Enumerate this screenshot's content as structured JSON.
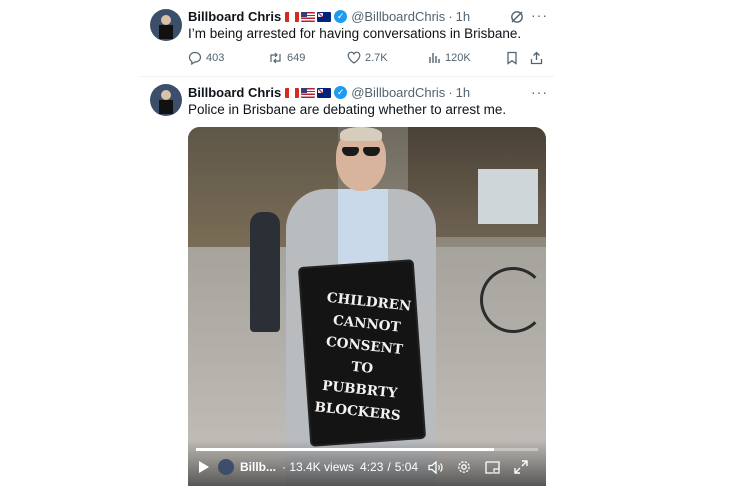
{
  "tweets": [
    {
      "author_name": "Billboard Chris",
      "handle": "@BillboardChris",
      "time": "1h",
      "text": "I’m being arrested for having conversations in Brisbane.",
      "replies": "403",
      "reposts": "649",
      "likes": "2.7K",
      "views": "120K"
    },
    {
      "author_name": "Billboard Chris",
      "handle": "@BillboardChris",
      "time": "1h",
      "text": "Police in Brisbane are debating whether to arrest me."
    }
  ],
  "video": {
    "sign_lines": [
      "CHILDREN",
      "CANNOT",
      "CONSENT TO",
      "PUBBRTY",
      "BLOCKERS"
    ],
    "channel_label": "Billb...",
    "views_label": "· 13.4K views",
    "current_time": "4:23",
    "separator": "/",
    "duration": "5:04",
    "progress_fraction": 0.87
  },
  "icons": {
    "grok": "grok-icon",
    "more": "more-icon",
    "reply": "reply-icon",
    "repost": "repost-icon",
    "like": "like-icon",
    "views": "views-icon",
    "bookmark": "bookmark-icon",
    "share": "share-icon",
    "play": "play-icon",
    "volume": "volume-icon",
    "settings": "settings-icon",
    "pip": "picture-in-picture-icon",
    "fullscreen": "fullscreen-icon"
  },
  "colors": {
    "verified": "#1d9bf0",
    "secondary_text": "#536471"
  }
}
